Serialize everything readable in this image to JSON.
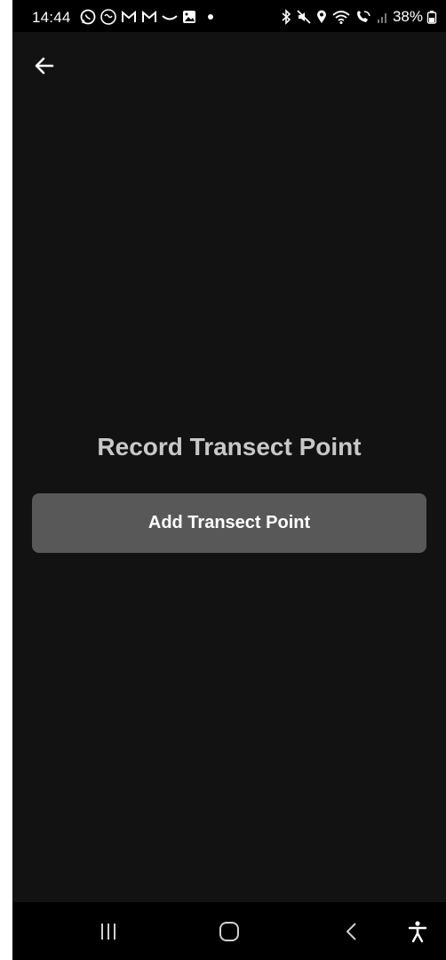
{
  "status_bar": {
    "time": "14:44",
    "battery": "38%",
    "left_icons": [
      "whatsapp-icon",
      "virgin-icon",
      "gmail-icon",
      "gmail-icon",
      "smile-icon",
      "gallery-icon",
      "dot-icon"
    ],
    "right_icons": [
      "bluetooth-icon",
      "mute-icon",
      "location-icon",
      "wifi-icon",
      "wifi-call-icon",
      "signal-icon",
      "battery-icon"
    ]
  },
  "app_bar": {
    "back_icon": "arrow-left-icon"
  },
  "main": {
    "title": "Record Transect Point",
    "add_button_label": "Add Transect Point"
  },
  "nav_bar": {
    "icons": [
      "recents-icon",
      "home-icon",
      "back-icon",
      "accessibility-icon"
    ]
  },
  "colors": {
    "background": "#121212",
    "status_bar": "#000000",
    "title_text": "#c8c8c8",
    "button_bg": "#585858",
    "button_text": "#ffffff"
  }
}
